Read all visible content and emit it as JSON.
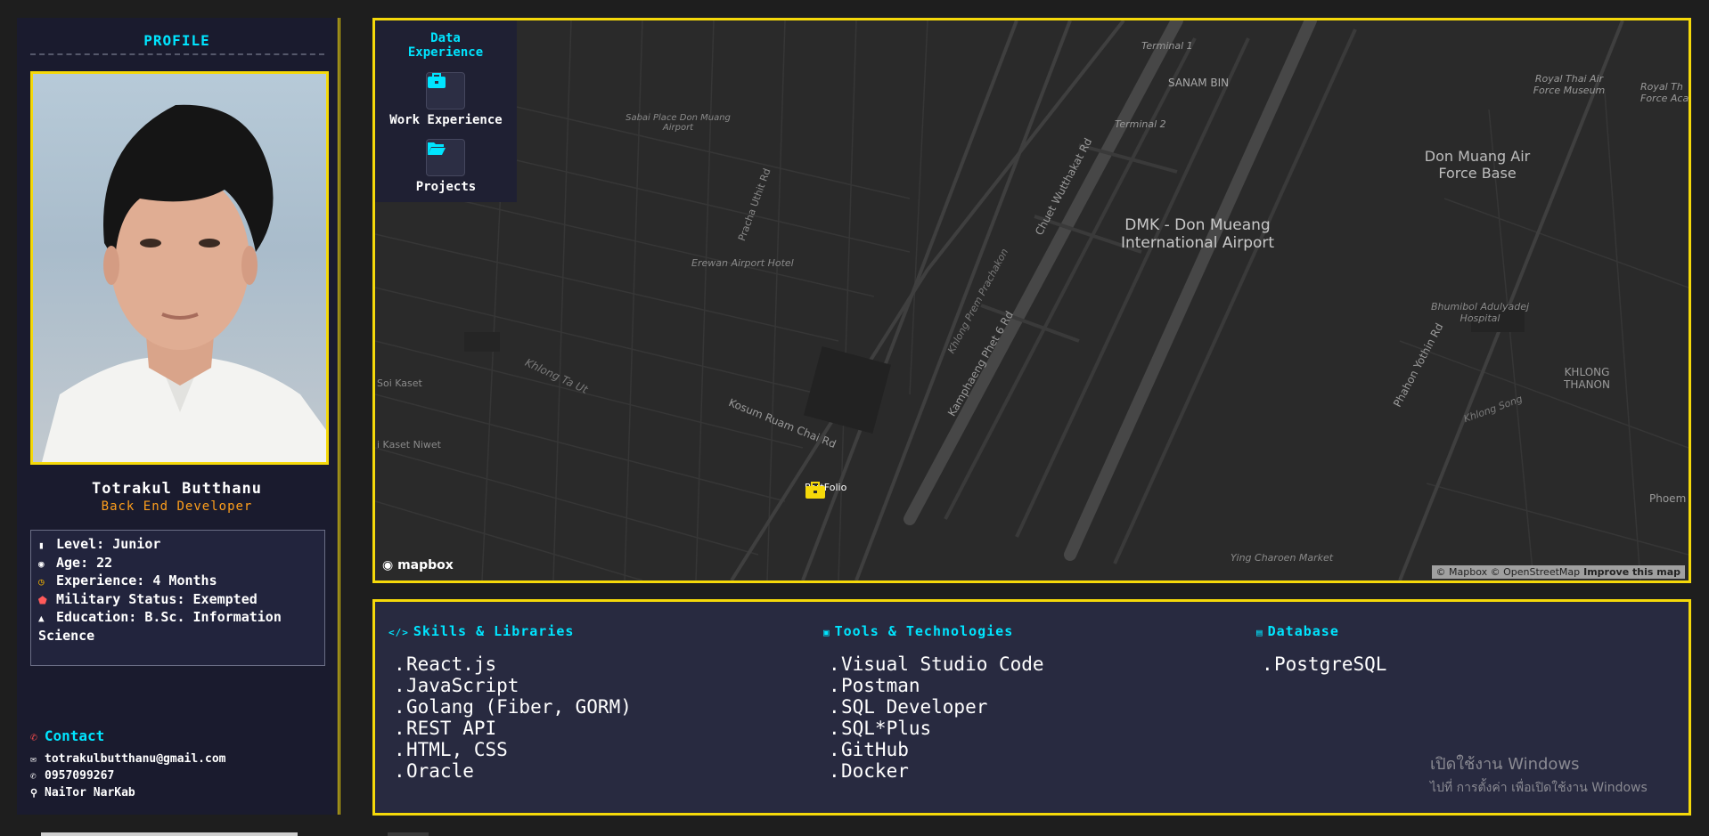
{
  "profile": {
    "title": "PROFILE",
    "name": "Totrakul Butthanu",
    "role": "Back End Developer",
    "info": [
      {
        "icon": "ticket-icon",
        "text": "Level: Junior"
      },
      {
        "icon": "cake-icon",
        "text": "Age: 22"
      },
      {
        "icon": "clock-icon",
        "text": "Experience: 4 Months"
      },
      {
        "icon": "shield-icon",
        "text": "Military Status: Exempted"
      },
      {
        "icon": "graduation-cap-icon",
        "text": "Education: B.Sc. Information Science"
      }
    ],
    "contact": {
      "title": "Contact",
      "email": "totrakulbutthanu@gmail.com",
      "phone": "0957099267",
      "location": "NaiTor NarKab"
    }
  },
  "data_panel": {
    "title": "Data Experience",
    "work_label": "Work Experience",
    "projects_label": "Projects"
  },
  "map": {
    "labels": {
      "terminal1": "Terminal 1",
      "terminal2": "Terminal 2",
      "sanam_bin": "SANAM BIN",
      "royal_thai_air_force_museum": "Royal Thai Air Force Museum",
      "royal_thai_air_force_acad": "Royal Th Force Aca",
      "don_muang_air_force_base": "Don Muang Air Force Base",
      "dmk": "DMK - Don Mueang International Airport",
      "sabai_place": "Sabai Place Don Muang Airport",
      "erewan": "Erewan Airport Hotel",
      "soi_kaset": "Soi Kaset",
      "kaset_niwet": "i Kaset Niwet",
      "kosum": "Kosum Ruam Chai Rd",
      "khlong_ta_ut": "Khlong Ta Ut",
      "kamphaeng": "Kamphaeng Phet 6 Rd",
      "chuet": "Chuet Wutthakat Rd",
      "khlong_prem": "Khlong Prem Prachakon",
      "bhumibol": "Bhumibol Adulyadej Hospital",
      "khlong_thanon": "KHLONG THANON",
      "phahon": "Phahon Yothin Rd",
      "ying_charoen": "Ying Charoen Market",
      "phoem": "Phoem",
      "pracha_uthit": "Pracha Uthit Rd",
      "khlong_song": "Khlong Song",
      "marker": "PortFolio"
    },
    "logo": "mapbox",
    "attribution": "© Mapbox © OpenStreetMap",
    "improve": "Improve this map"
  },
  "skills": {
    "libraries": {
      "title": "Skills & Libraries",
      "icon": "code-icon",
      "items": [
        "React.js",
        "JavaScript",
        "Golang (Fiber, GORM)",
        "REST API",
        "HTML, CSS",
        "Oracle"
      ]
    },
    "tools": {
      "title": "Tools & Technologies",
      "icon": "toolbox-icon",
      "items": [
        "Visual Studio Code",
        "Postman",
        "SQL Developer",
        "SQL*Plus",
        "GitHub",
        "Docker"
      ]
    },
    "database": {
      "title": "Database",
      "icon": "database-icon",
      "items": [
        "PostgreSQL"
      ]
    }
  },
  "watermark": {
    "line1": "เปิดใช้งาน Windows",
    "line2": "ไปที่ การตั้งค่า เพื่อเปิดใช้งาน Windows"
  },
  "colors": {
    "accent_yellow": "#f5d90a",
    "accent_cyan": "#00e5ff",
    "role_orange": "#ff9f1c",
    "panel_bg": "#1a1b2e"
  }
}
